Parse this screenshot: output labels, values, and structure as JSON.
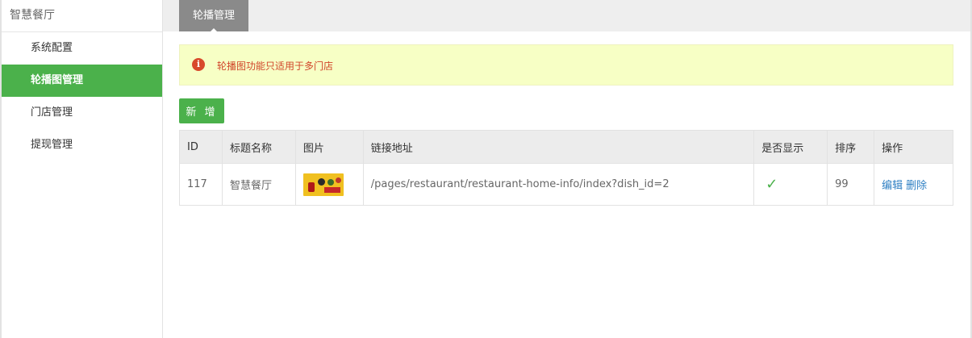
{
  "sidebar": {
    "title": "智慧餐厅",
    "items": [
      {
        "label": "系统配置",
        "active": false
      },
      {
        "label": "轮播图管理",
        "active": true
      },
      {
        "label": "门店管理",
        "active": false
      },
      {
        "label": "提现管理",
        "active": false
      }
    ]
  },
  "tabs": [
    {
      "label": "轮播管理"
    }
  ],
  "notice": {
    "icon": "info-circle-icon",
    "text": "轮播图功能只适用于多门店"
  },
  "toolbar": {
    "add_label": "新 增"
  },
  "table": {
    "headers": [
      "ID",
      "标题名称",
      "图片",
      "链接地址",
      "是否显示",
      "排序",
      "操作"
    ],
    "rows": [
      {
        "id": "117",
        "title": "智慧餐厅",
        "image": "banner-thumbnail",
        "link": "/pages/restaurant/restaurant-home-info/index?dish_id=2",
        "visible_icon": "check-icon",
        "sort": "99",
        "edit_label": "编辑",
        "delete_label": "删除"
      }
    ]
  },
  "colors": {
    "accent": "#4bb14b",
    "notice_bg": "#f7ffc5",
    "notice_text": "#d1452a",
    "link": "#2e7fc3"
  }
}
